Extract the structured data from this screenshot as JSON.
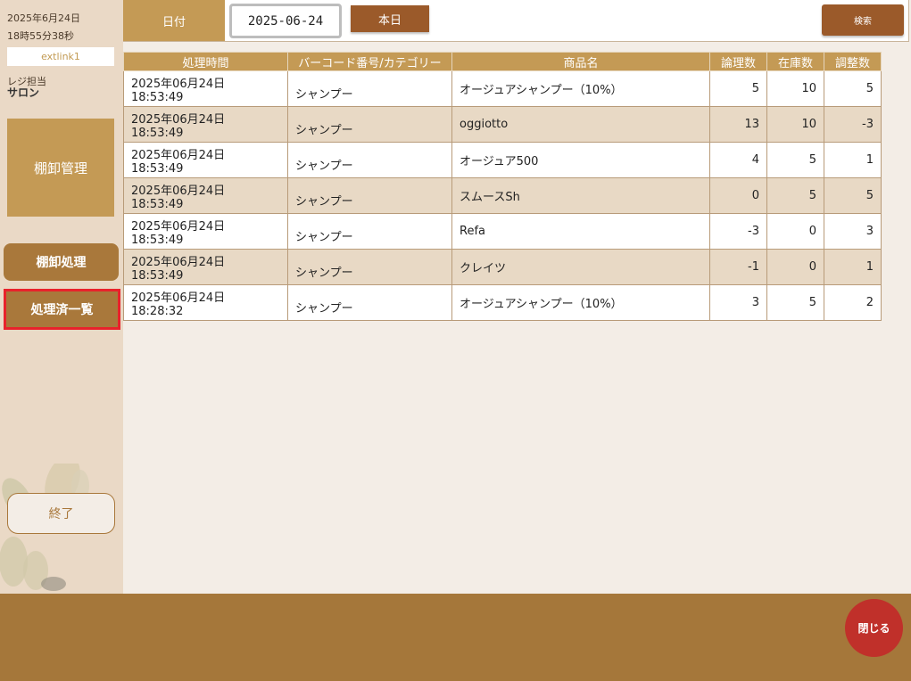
{
  "sidebar": {
    "date": "2025年6月24日",
    "time": "18時55分38秒",
    "user": "extlink1",
    "register_label": "レジ担当",
    "register_name": "サロン",
    "tile_label": "棚卸管理",
    "btn_process": "棚卸処理",
    "btn_processed_list": "処理済一覧",
    "btn_end": "終了"
  },
  "topbar": {
    "date_label": "日付",
    "date_value": "2025-06-24",
    "today_label": "本日",
    "search_label": "検索"
  },
  "table": {
    "headers": [
      "処理時間",
      "バーコード番号/カテゴリー",
      "商品名",
      "論理数",
      "在庫数",
      "調整数"
    ],
    "rows": [
      [
        "2025年06月24日 18:53:49",
        "シャンプー",
        "オージュアシャンプー（10%）",
        "5",
        "10",
        "5"
      ],
      [
        "2025年06月24日 18:53:49",
        "シャンプー",
        "oggiotto",
        "13",
        "10",
        "-3"
      ],
      [
        "2025年06月24日 18:53:49",
        "シャンプー",
        "オージュア500",
        "4",
        "5",
        "1"
      ],
      [
        "2025年06月24日 18:53:49",
        "シャンプー",
        "スムースSh",
        "0",
        "5",
        "5"
      ],
      [
        "2025年06月24日 18:53:49",
        "シャンプー",
        "Refa",
        "-3",
        "0",
        "3"
      ],
      [
        "2025年06月24日 18:53:49",
        "シャンプー",
        "クレイツ",
        "-1",
        "0",
        "1"
      ],
      [
        "2025年06月24日 18:28:32",
        "シャンプー",
        "オージュアシャンプー（10%）",
        "3",
        "5",
        "2"
      ]
    ]
  },
  "footer": {
    "close_label": "閉じる"
  },
  "colors": {
    "accent": "#c49a55",
    "button_dark": "#9b5a2a",
    "footer": "#a5773a",
    "close": "#c0302a",
    "highlight": "#e8222b"
  }
}
